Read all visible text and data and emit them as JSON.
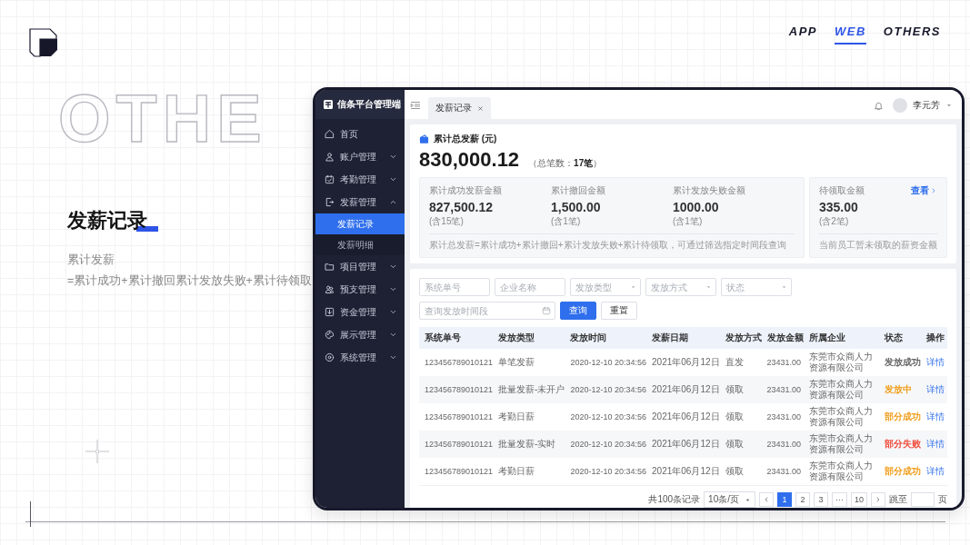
{
  "nav": [
    {
      "label": "APP",
      "selected": false
    },
    {
      "label": "WEB",
      "selected": true
    },
    {
      "label": "OTHERS",
      "selected": false
    }
  ],
  "intro": {
    "ghost_title": "OTHE",
    "title": "发薪记录",
    "lines": [
      "累计发薪",
      "=累计成功+累计撤回累计发放失败+累计待领取"
    ]
  },
  "app": {
    "brand": "信条平台管理端",
    "menu": [
      {
        "label": "首页"
      },
      {
        "label": "账户管理",
        "expanded": false
      },
      {
        "label": "考勤管理",
        "expanded": false
      },
      {
        "label": "发薪管理",
        "expanded": true,
        "children": [
          {
            "label": "发薪记录",
            "selected": true
          },
          {
            "label": "发薪明细",
            "selected": false
          }
        ]
      },
      {
        "label": "项目管理",
        "expanded": false
      },
      {
        "label": "预支管理",
        "expanded": false
      },
      {
        "label": "资金管理",
        "expanded": false
      },
      {
        "label": "展示管理",
        "expanded": false
      },
      {
        "label": "系统管理",
        "expanded": false
      }
    ],
    "tabs": [
      {
        "label": "发薪记录",
        "selected": true
      }
    ],
    "user": {
      "name": "李元芳"
    },
    "summary": {
      "title": "累计总发薪 (元)",
      "total": "830,000.12",
      "count_note": "（总笔数：**17笔**）",
      "stats": [
        {
          "label": "累计成功发薪金额",
          "value": "827,500.12",
          "count": "(含15笔)"
        },
        {
          "label": "累计撤回金额",
          "value": "1,500.00",
          "count": "(含1笔)"
        },
        {
          "label": "累计发放失败金额",
          "value": "1000.00",
          "count": "(含1笔)"
        }
      ],
      "stats_note": "累计总发薪=累计成功+累计撤回+累计发放失败+累计待领取，可通过筛选指定时间段查询",
      "pending": {
        "label": "待领取金额",
        "link": "查看",
        "value": "335.00",
        "count": "(含2笔)",
        "note": "当前员工暂未领取的薪资金额"
      }
    },
    "records": {
      "filters": [
        {
          "placeholder": "系统单号",
          "kind": "text"
        },
        {
          "placeholder": "企业名称",
          "kind": "text"
        },
        {
          "placeholder": "发放类型",
          "kind": "select"
        },
        {
          "placeholder": "发放方式",
          "kind": "select"
        },
        {
          "placeholder": "状态",
          "kind": "select"
        },
        {
          "placeholder": "查询发放时间段",
          "kind": "date"
        }
      ],
      "buttons": [
        {
          "label": "查询",
          "kind": "primary"
        },
        {
          "label": "重置",
          "kind": "default"
        }
      ],
      "table": {
        "columns": [
          "系统单号",
          "发放类型",
          "发放时间",
          "发薪日期",
          "发放方式",
          "发放金额",
          "所属企业",
          "状态",
          "操作"
        ],
        "rows": [
          {
            "cells": [
              "123456789010121",
              "单笔发薪",
              "2020-12-10  20:34:56",
              "2021年06月12日",
              "直发",
              "23431.00",
              "东莞市众商人力资源有限公司"
            ],
            "status": {
              "label": "发放成功",
              "color": "#666666"
            },
            "action": "详情"
          },
          {
            "cells": [
              "123456789010121",
              "批量发薪-未开户",
              "2020-12-10  20:34:56",
              "2021年06月12日",
              "领取",
              "23431.00",
              "东莞市众商人力资源有限公司"
            ],
            "status": {
              "label": "发放中",
              "color": "#f0a020"
            },
            "action": "详情"
          },
          {
            "cells": [
              "123456789010121",
              "考勤日薪",
              "2020-12-10  20:34:56",
              "2021年06月12日",
              "领取",
              "23431.00",
              "东莞市众商人力资源有限公司"
            ],
            "status": {
              "label": "部分成功",
              "color": "#f0a020"
            },
            "action": "详情"
          },
          {
            "cells": [
              "123456789010121",
              "批量发薪-实时",
              "2020-12-10  20:34:56",
              "2021年06月12日",
              "领取",
              "23431.00",
              "东莞市众商人力资源有限公司"
            ],
            "status": {
              "label": "部分失败",
              "color": "#f04c3c"
            },
            "action": "详情"
          },
          {
            "cells": [
              "123456789010121",
              "考勤日薪",
              "2020-12-10  20:34:56",
              "2021年06月12日",
              "领取",
              "23431.00",
              "东莞市众商人力资源有限公司"
            ],
            "status": {
              "label": "部分成功",
              "color": "#f0a020"
            },
            "action": "详情"
          }
        ]
      },
      "pagination": {
        "total": "共100条记录",
        "page_size": "10条/页",
        "pages": [
          {
            "label": "1",
            "selected": true
          },
          {
            "label": "2",
            "selected": false
          },
          {
            "label": "3",
            "selected": false
          },
          {
            "label": "···",
            "selected": false
          },
          {
            "label": "10",
            "selected": false
          }
        ],
        "jump_label": "跳至",
        "suffix": "页"
      }
    }
  }
}
